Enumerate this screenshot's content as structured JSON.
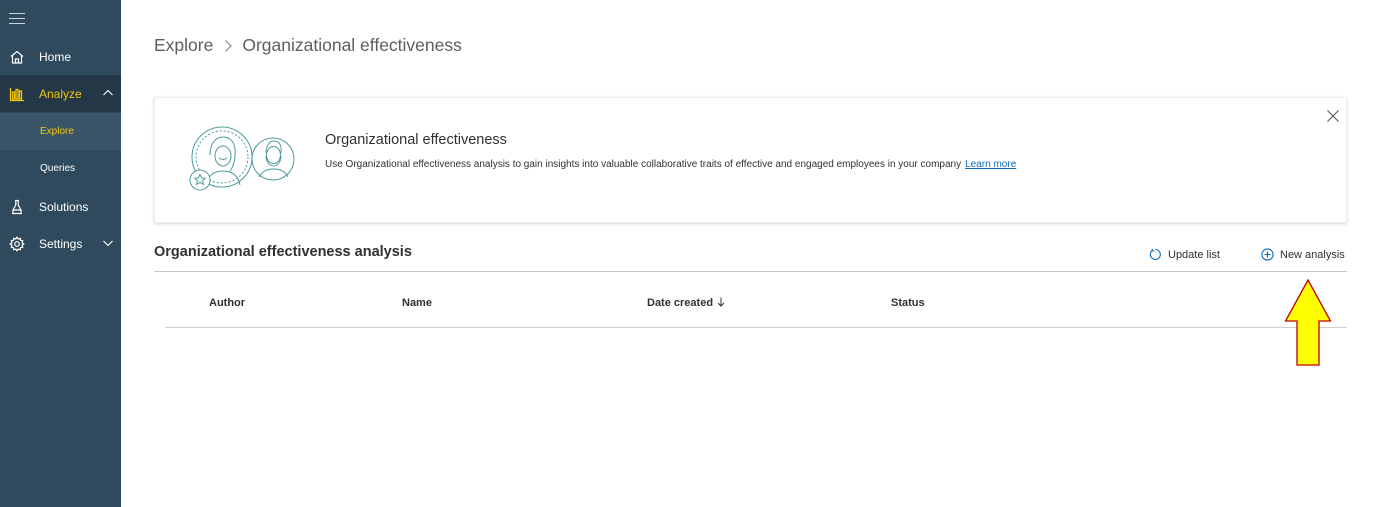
{
  "sidebar": {
    "menu_icon": "hamburger-icon",
    "items": [
      {
        "label": "Home",
        "icon": "home-icon"
      },
      {
        "label": "Analyze",
        "icon": "bar-chart-icon",
        "expanded": true
      },
      {
        "label": "Solutions",
        "icon": "flask-icon"
      },
      {
        "label": "Settings",
        "icon": "gear-icon"
      }
    ],
    "subitems": [
      {
        "label": "Explore",
        "active": true
      },
      {
        "label": "Queries"
      }
    ],
    "colors": {
      "background": "#2f4a5c",
      "active_background": "#233746",
      "accent": "#f2c811"
    }
  },
  "breadcrumb": {
    "root": "Explore",
    "current": "Organizational effectiveness"
  },
  "banner": {
    "title": "Organizational effectiveness",
    "description": "Use Organizational effectiveness analysis to gain insights into valuable collaborative traits of effective and engaged employees in your company",
    "link": "Learn more",
    "illustration": "people-illustration",
    "close_icon": "close-icon"
  },
  "analysis": {
    "title": "Organizational effectiveness analysis",
    "update_label": "Update list",
    "new_label": "New analysis",
    "columns": [
      "Author",
      "Name",
      "Date created",
      "Status"
    ],
    "sort_column": "Date created",
    "sort_direction": "descending",
    "rows": []
  },
  "annotation": {
    "type": "arrow-up",
    "fill": "#ffff00",
    "stroke": "#c00000"
  }
}
